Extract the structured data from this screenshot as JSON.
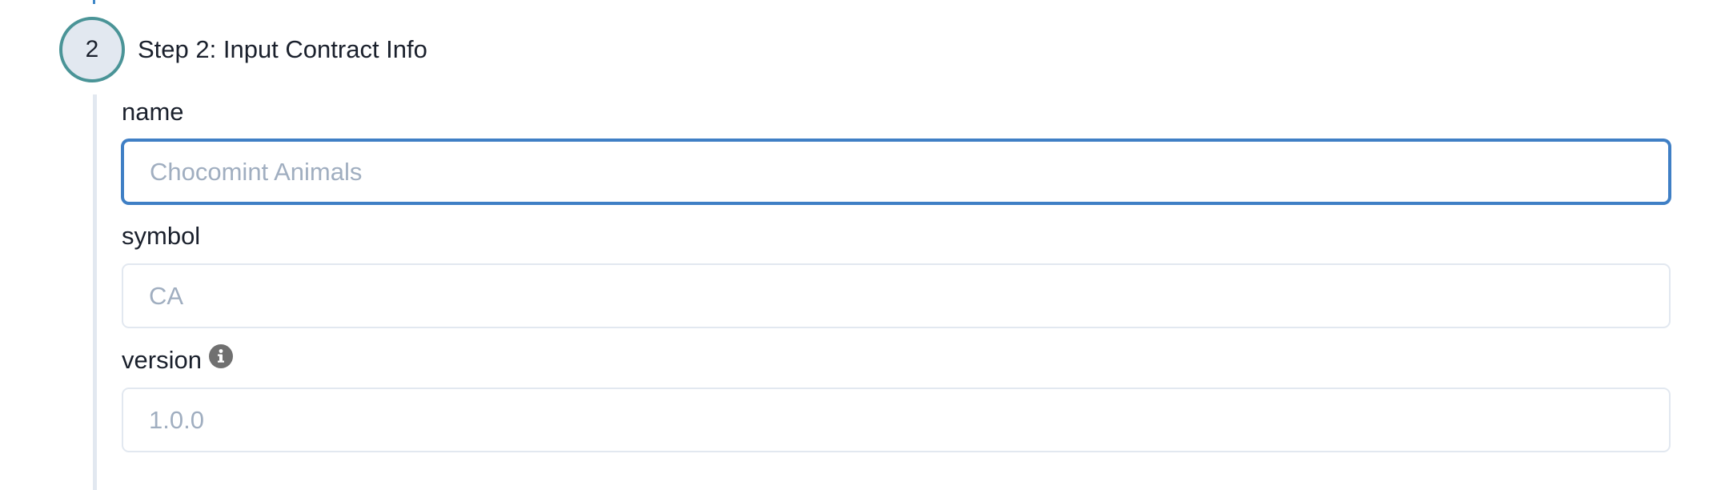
{
  "step": {
    "number": "2",
    "title": "Step 2: Input Contract Info"
  },
  "fields": {
    "name": {
      "label": "name",
      "placeholder": "Chocomint Animals",
      "value": ""
    },
    "symbol": {
      "label": "symbol",
      "placeholder": "CA",
      "value": ""
    },
    "version": {
      "label": "version",
      "placeholder": "1.0.0",
      "value": "",
      "info_icon": "info-circle-icon"
    }
  },
  "colors": {
    "step_circle_border": "#4a9497",
    "step_circle_fill": "#e2e8f0",
    "focus_border": "#3f7fc5",
    "input_border": "#e2e8f0",
    "placeholder": "#a0aec0",
    "rail": "#e2e8f0"
  }
}
